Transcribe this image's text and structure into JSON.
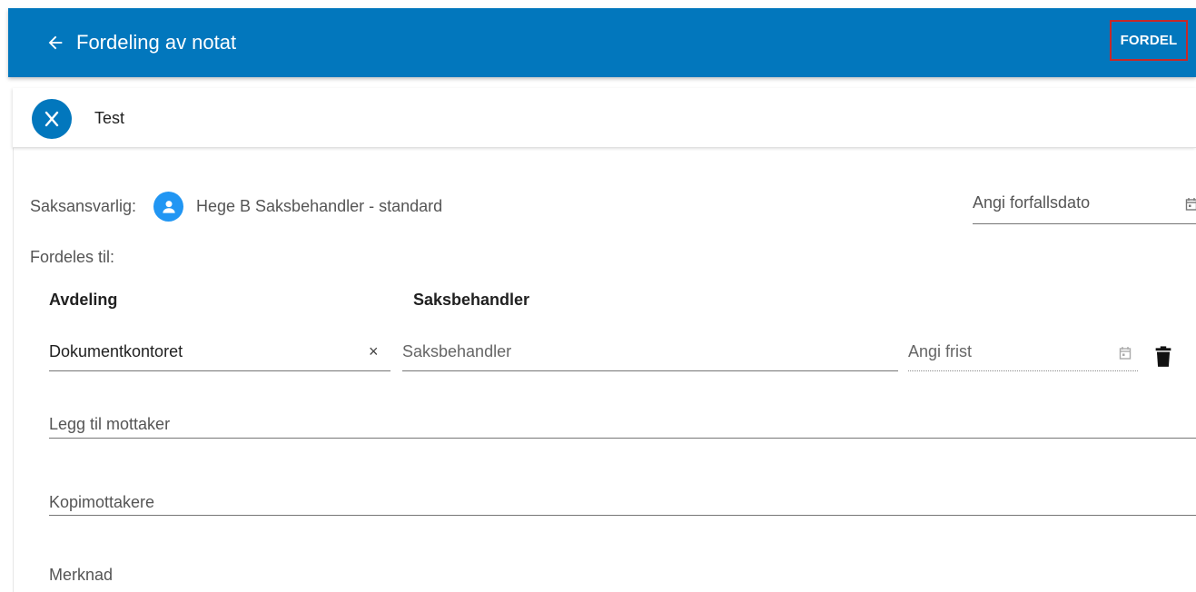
{
  "app": {
    "title": "Fordeling av notat",
    "action_label": "FORDEL",
    "accent": "#0277bd"
  },
  "header": {
    "title": "Test",
    "avatar_icon": "close-icon"
  },
  "saksansvarlig": {
    "label": "Saksansvarlig:",
    "name": "Hege B Saksbehandler - standard",
    "icon": "person-icon"
  },
  "forfallsdato": {
    "placeholder": "Angi forfallsdato",
    "icon": "calendar-icon"
  },
  "fordeles": {
    "label": "Fordeles til:",
    "columns": [
      "Avdeling",
      "Saksbehandler"
    ],
    "rows": [
      {
        "avdeling": "Dokumentkontoret",
        "saksbehandler_placeholder": "Saksbehandler",
        "frist_placeholder": "Angi frist",
        "clear_glyph": "×"
      }
    ]
  },
  "mottaker": {
    "placeholder": "Legg til mottaker"
  },
  "kopimottakere": {
    "placeholder": "Kopimottakere"
  },
  "merknad": {
    "label": "Merknad"
  }
}
